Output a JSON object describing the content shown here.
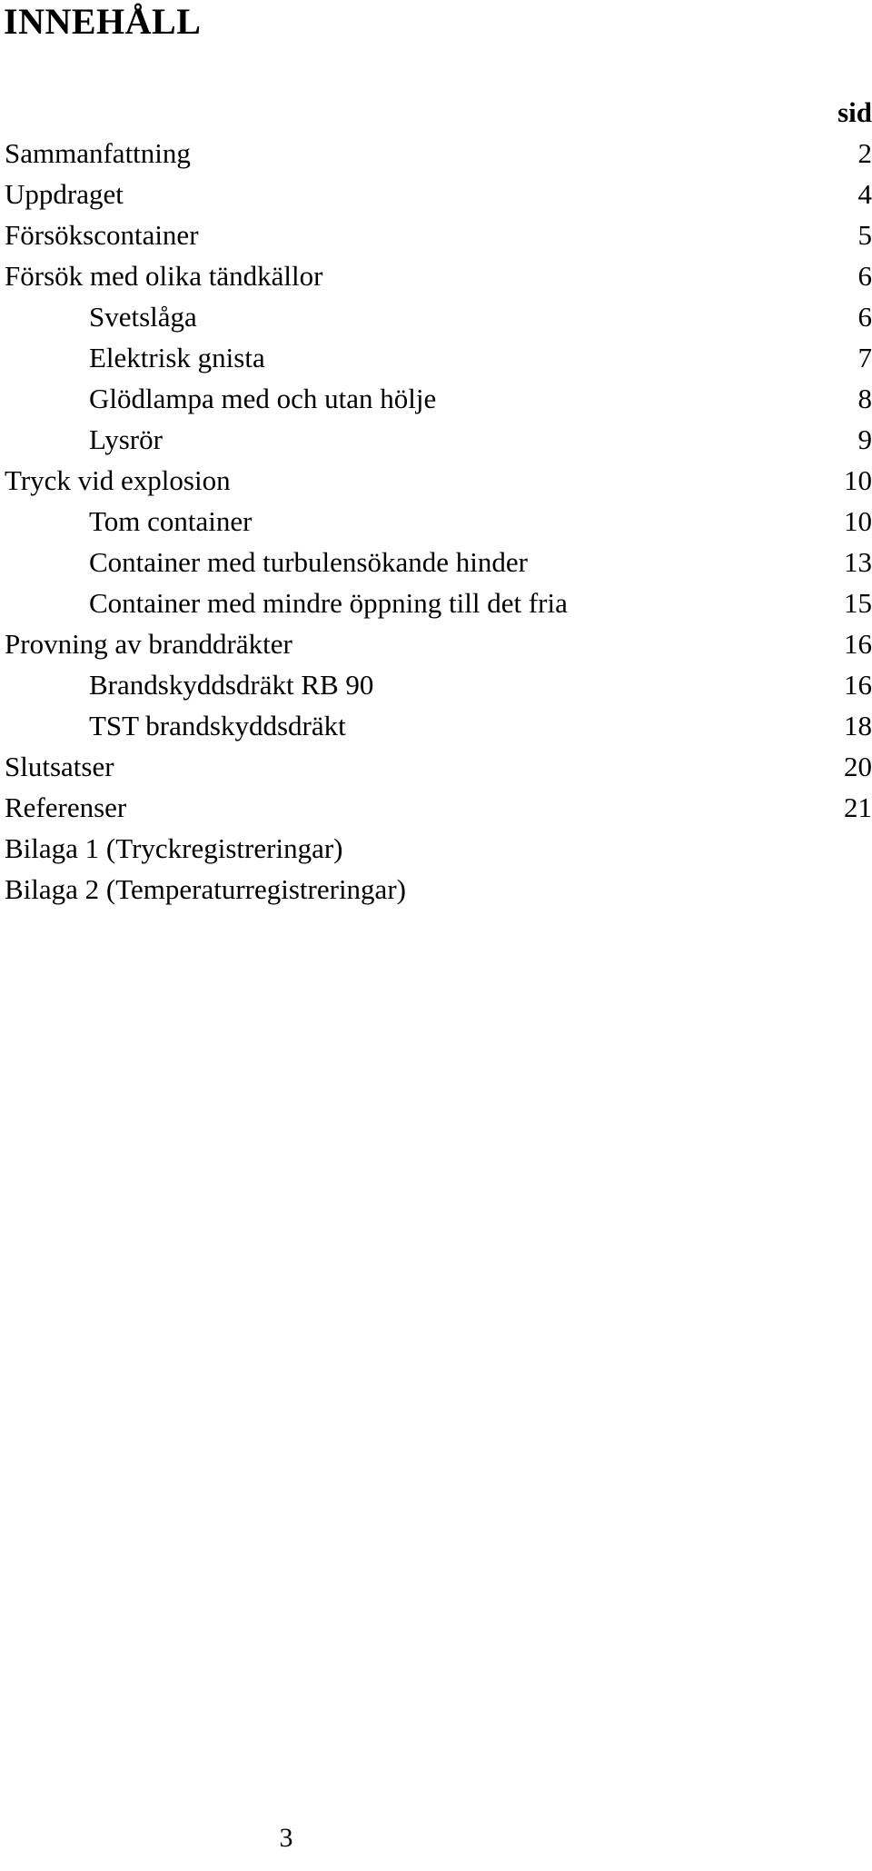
{
  "document": {
    "title": "INNEHÅLL",
    "footer_page_number": "3"
  },
  "toc": {
    "page_column_header": "sid",
    "entries": [
      {
        "label": "Sammanfattning",
        "page": "2",
        "level": 0
      },
      {
        "label": "Uppdraget",
        "page": "4",
        "level": 0
      },
      {
        "label": "Försökscontainer",
        "page": "5",
        "level": 0
      },
      {
        "label": "Försök med olika tändkällor",
        "page": "6",
        "level": 0
      },
      {
        "label": "Svetslåga",
        "page": "6",
        "level": 1
      },
      {
        "label": "Elektrisk gnista",
        "page": "7",
        "level": 1
      },
      {
        "label": "Glödlampa med och utan hölje",
        "page": "8",
        "level": 1
      },
      {
        "label": "Lysrör",
        "page": "9",
        "level": 1
      },
      {
        "label": "Tryck vid explosion",
        "page": "10",
        "level": 0
      },
      {
        "label": "Tom container",
        "page": "10",
        "level": 1
      },
      {
        "label": "Container med turbulensökande hinder",
        "page": "13",
        "level": 1
      },
      {
        "label": "Container med mindre öppning till det fria",
        "page": "15",
        "level": 1
      },
      {
        "label": "Provning av branddräkter",
        "page": "16",
        "level": 0
      },
      {
        "label": "Brandskyddsdräkt RB 90",
        "page": "16",
        "level": 1
      },
      {
        "label": "TST brandskyddsdräkt",
        "page": "18",
        "level": 1
      },
      {
        "label": "Slutsatser",
        "page": "20",
        "level": 0
      },
      {
        "label": "Referenser",
        "page": "21",
        "level": 0
      },
      {
        "label": "Bilaga 1   (Tryckregistreringar)",
        "page": "",
        "level": 0
      },
      {
        "label": "Bilaga 2  (Temperaturregistreringar)",
        "page": "",
        "level": 0
      }
    ]
  }
}
